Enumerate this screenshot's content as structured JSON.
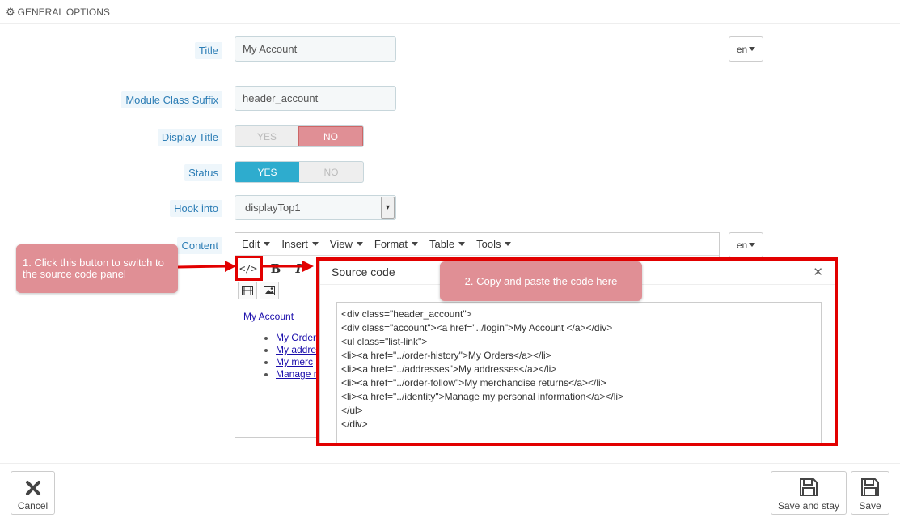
{
  "header": {
    "title": "GENERAL OPTIONS",
    "icon": "gears-icon"
  },
  "fields": {
    "title_label": "Title",
    "title_value": "My Account",
    "suffix_label": "Module Class Suffix",
    "suffix_value": "header_account",
    "display_title_label": "Display Title",
    "status_label": "Status",
    "hook_label": "Hook into",
    "hook_value": "displayTop1",
    "content_label": "Content",
    "yes": "YES",
    "no": "NO"
  },
  "lang": {
    "title_lang": "en",
    "content_lang": "en"
  },
  "editor": {
    "menus": [
      "Edit",
      "Insert",
      "View",
      "Format",
      "Table",
      "Tools"
    ],
    "link_text": "My Account",
    "list_items": [
      "My Orders",
      "My addresses",
      "My merchandise returns",
      "Manage my personal information"
    ],
    "list_visible": [
      "My Order",
      "My addre",
      "My merc",
      "Manage m"
    ]
  },
  "source_dialog": {
    "title": "Source code",
    "lines": [
      "<div class=\"header_account\">",
      "<div class=\"account\"><a href=\"../login\">My Account </a></div>",
      "<ul class=\"list-link\">",
      "<li><a href=\"../order-history\">My Orders</a></li>",
      "<li><a href=\"../addresses\">My addresses</a></li>",
      "<li><a href=\"../order-follow\">My merchandise returns</a></li>",
      "<li><a href=\"../identity\">Manage my personal information</a></li>",
      "</ul>",
      "</div>"
    ]
  },
  "callouts": {
    "step1": "1. Click this button to switch to the source code panel",
    "step2": "2. Copy and paste the code here"
  },
  "footer": {
    "cancel": "Cancel",
    "save_stay": "Save and stay",
    "save": "Save"
  },
  "colors": {
    "accent_blue": "#2eacce",
    "no_red": "#e08f95",
    "highlight_red": "#e20000"
  }
}
